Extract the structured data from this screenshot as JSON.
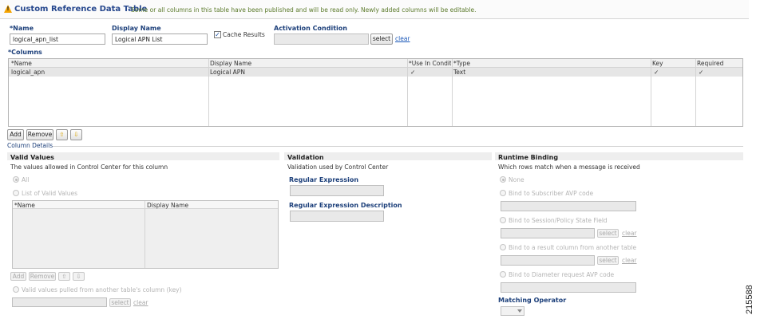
{
  "header": {
    "title": "Custom Reference Data Table",
    "message": "Some or all columns in this table have been published and will be read only. Newly added columns will be editable."
  },
  "form": {
    "name_label": "*Name",
    "name_value": "logical_apn_list",
    "display_name_label": "Display Name",
    "display_name_value": "Logical APN List",
    "cache_results_label": "Cache Results",
    "cache_results_checked": true,
    "activation_label": "Activation Condition",
    "activation_value": "",
    "select_label": "select",
    "clear_label": "clear"
  },
  "columns": {
    "label": "*Columns",
    "headers": [
      "*Name",
      "Display Name",
      "*Use In Conditi",
      "*Type",
      "Key",
      "Required"
    ],
    "rows": [
      {
        "name": "logical_apn",
        "display_name": "Logical APN",
        "use_in_conditions": "✓",
        "type": "Text",
        "key": "✓",
        "required": "✓"
      }
    ],
    "add_label": "Add",
    "remove_label": "Remove"
  },
  "column_details": {
    "label": "Column Details",
    "valid_values": {
      "title": "Valid Values",
      "desc": "The values allowed in Control Center for this column",
      "all_label": "All",
      "list_label": "List of Valid Values",
      "table_headers": [
        "*Name",
        "Display Name"
      ],
      "add_label": "Add",
      "remove_label": "Remove",
      "pulled_label": "Valid values pulled from another table's column (key)",
      "select_label": "select",
      "clear_label": "clear"
    },
    "validation": {
      "title": "Validation",
      "desc": "Validation used by Control Center",
      "regex_label": "Regular Expression",
      "regex_desc_label": "Regular Expression Description"
    },
    "runtime_binding": {
      "title": "Runtime Binding",
      "desc": "Which rows match when a message is received",
      "none_label": "None",
      "subscriber_label": "Bind to Subscriber AVP code",
      "session_label": "Bind to Session/Policy State Field",
      "result_label": "Bind to a result column from another table",
      "diameter_label": "Bind to Diameter request AVP code",
      "select_label": "select",
      "clear_label": "clear",
      "matching_operator_label": "Matching Operator"
    }
  },
  "figure_number": "215588"
}
